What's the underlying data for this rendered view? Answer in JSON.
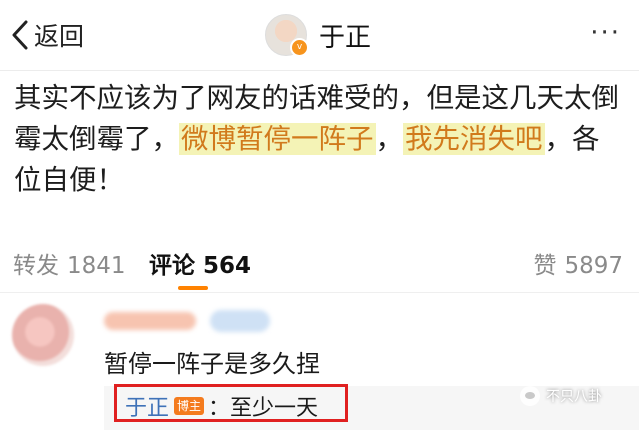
{
  "header": {
    "back_label": "返回",
    "title": "于正",
    "more_label": "···"
  },
  "post": {
    "text_1": "其实不应该为了网友的话难受的，但是这几天太倒霉太倒霉了，",
    "highlight_1": "微博暂停一阵子",
    "text_2": "，",
    "highlight_2": "我先消失吧",
    "text_3": "，各位自便！"
  },
  "tabs": [
    {
      "label": "转发",
      "count": "1841"
    },
    {
      "label": "评论",
      "count": "564"
    },
    {
      "label": "赞",
      "count": "5897"
    }
  ],
  "comment": {
    "text": "暂停一阵子是多久捏",
    "reply": {
      "name": "于正",
      "badge": "博主",
      "text": "：至少一天"
    }
  },
  "watermark": {
    "text": "不只八卦"
  },
  "colors": {
    "accent": "#ff8200",
    "highlight_bg": "#f4f3b6",
    "highlight_text": "#d17a1c",
    "reply_name": "#3f72b8",
    "annotation_box": "#e02020"
  }
}
